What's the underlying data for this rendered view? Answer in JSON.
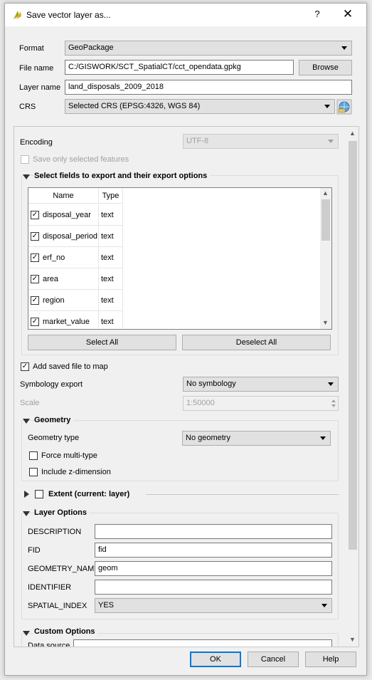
{
  "window": {
    "title": "Save vector layer as...",
    "help": "?",
    "close": "✕"
  },
  "form": {
    "format_label": "Format",
    "format_value": "GeoPackage",
    "filename_label": "File name",
    "filename_value": "C:/GISWORK/SCT_SpatialCT/cct_opendata.gpkg",
    "browse_label": "Browse",
    "layername_label": "Layer name",
    "layername_value": "land_disposals_2009_2018",
    "crs_label": "CRS",
    "crs_value": "Selected CRS (EPSG:4326, WGS 84)"
  },
  "panel": {
    "encoding_label": "Encoding",
    "encoding_value": "UTF-8",
    "save_selected_label": "Save only selected features",
    "fields_section_title": "Select fields to export and their export options",
    "table": {
      "col_name": "Name",
      "col_type": "Type",
      "rows": [
        {
          "name": "disposal_year",
          "type": "text",
          "checked": true
        },
        {
          "name": "disposal_period",
          "type": "text",
          "checked": true
        },
        {
          "name": "erf_no",
          "type": "text",
          "checked": true
        },
        {
          "name": "area",
          "type": "text",
          "checked": true
        },
        {
          "name": "region",
          "type": "text",
          "checked": true
        },
        {
          "name": "market_value",
          "type": "text",
          "checked": true
        }
      ]
    },
    "select_all": "Select All",
    "deselect_all": "Deselect All",
    "add_saved_label": "Add saved file to map",
    "symbology_label": "Symbology export",
    "symbology_value": "No symbology",
    "scale_label": "Scale",
    "scale_value": "1:50000",
    "geometry_section_title": "Geometry",
    "geometry_type_label": "Geometry type",
    "geometry_type_value": "No geometry",
    "force_multi_label": "Force multi-type",
    "include_z_label": "Include z-dimension",
    "extent_section_title": "Extent (current: layer)",
    "layer_options_title": "Layer Options",
    "description_label": "DESCRIPTION",
    "description_value": "",
    "fid_label": "FID",
    "fid_value": "fid",
    "geometry_name_label": "GEOMETRY_NAME",
    "geometry_name_value": "geom",
    "identifier_label": "IDENTIFIER",
    "identifier_value": "",
    "spatial_index_label": "SPATIAL_INDEX",
    "spatial_index_value": "YES",
    "custom_options_title": "Custom Options",
    "data_source_label": "Data source"
  },
  "buttons": {
    "ok": "OK",
    "cancel": "Cancel",
    "help": "Help"
  },
  "check_glyph": "✓",
  "colors": {
    "dialog_bg": "#f0f0f0",
    "primary_button_border": "#0078d7"
  }
}
